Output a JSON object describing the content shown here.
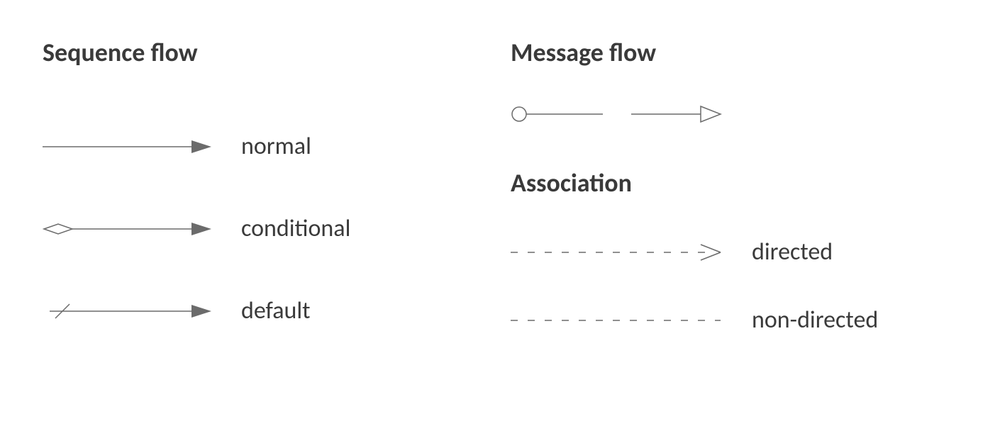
{
  "sequenceFlow": {
    "heading": "Sequence flow",
    "items": [
      {
        "label": "normal"
      },
      {
        "label": "conditional"
      },
      {
        "label": "default"
      }
    ]
  },
  "messageFlow": {
    "heading": "Message flow"
  },
  "association": {
    "heading": "Association",
    "items": [
      {
        "label": "directed"
      },
      {
        "label": "non-directed"
      }
    ]
  }
}
